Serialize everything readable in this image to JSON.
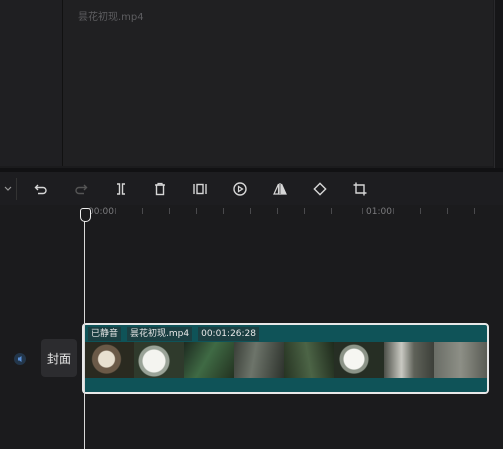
{
  "preview": {
    "title": "昙花初现.mp4"
  },
  "toolbar": {
    "tools": [
      {
        "name": "undo-icon"
      },
      {
        "name": "redo-icon"
      },
      {
        "name": "split-icon"
      },
      {
        "name": "delete-icon"
      },
      {
        "name": "freeze-frame-icon"
      },
      {
        "name": "play-reverse-icon"
      },
      {
        "name": "mirror-icon"
      },
      {
        "name": "rotate-icon"
      },
      {
        "name": "crop-icon"
      }
    ]
  },
  "timeline": {
    "ruler_labels": [
      "00:00",
      "01:00"
    ],
    "cover_label": "封面",
    "clip": {
      "muted_label": "已静音",
      "filename": "昙花初现.mp4",
      "duration": "00:01:26:28"
    }
  },
  "colors": {
    "clip_teal": "#0f5358",
    "background": "#1b1b1d"
  }
}
